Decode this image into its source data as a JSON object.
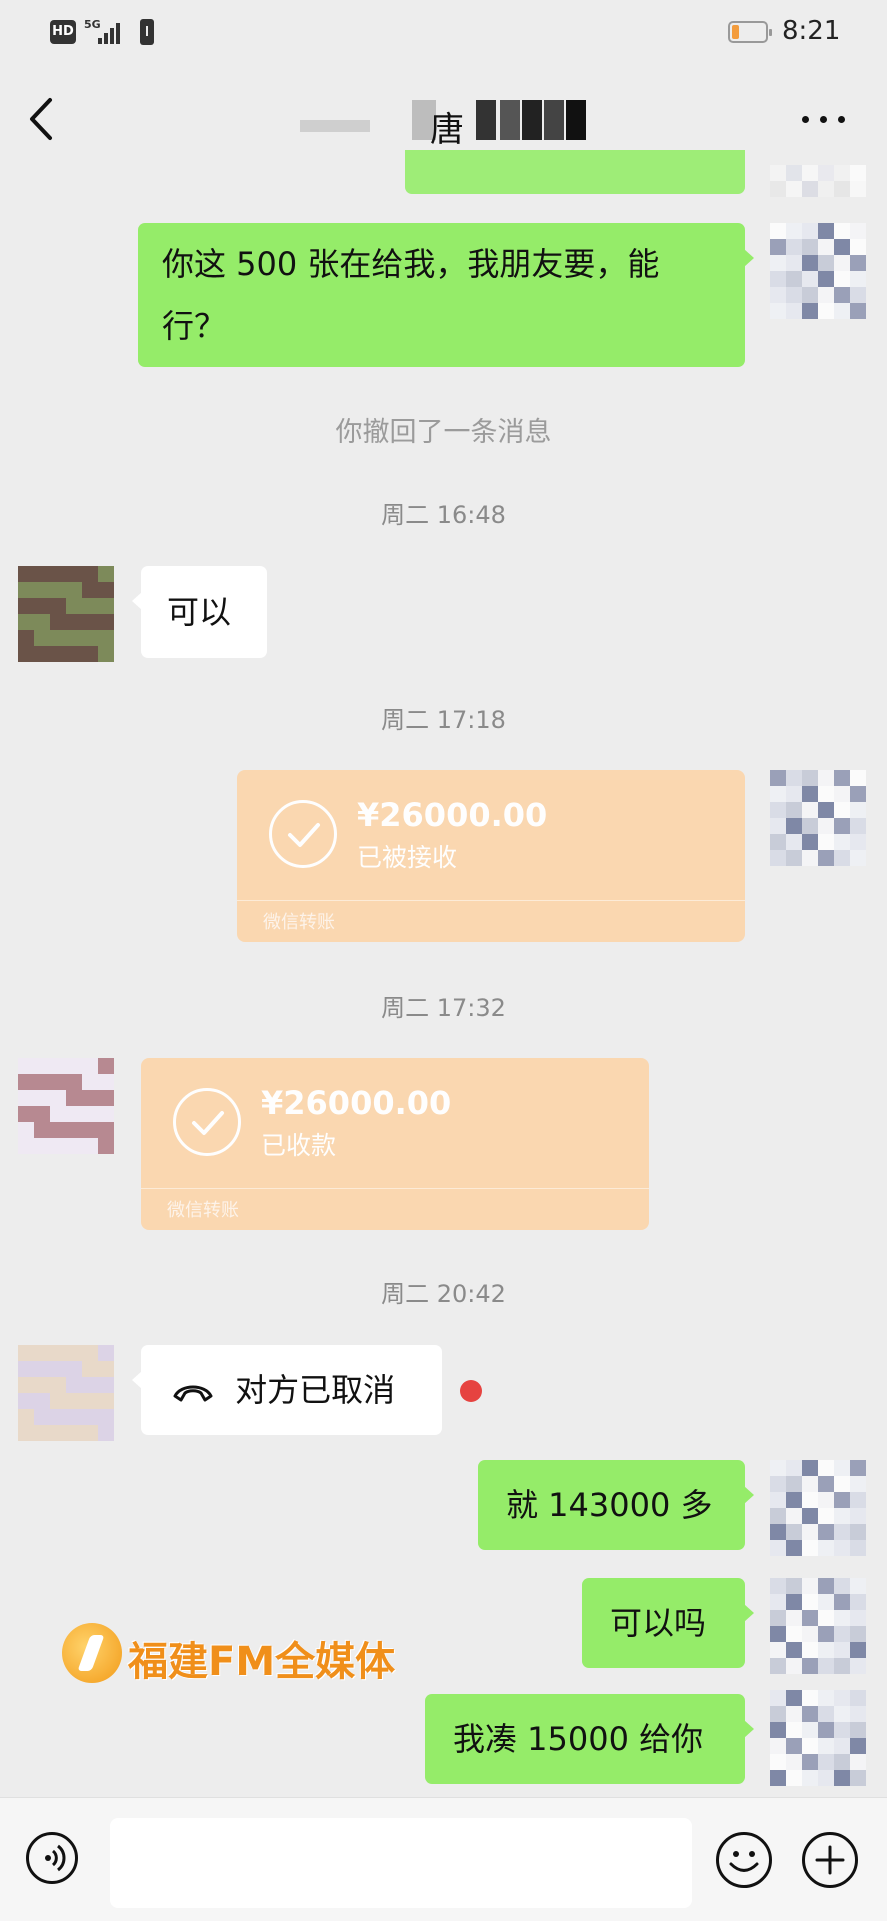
{
  "status_bar": {
    "hd": "HD",
    "network": "5G",
    "time": "8:21"
  },
  "header": {
    "title": "唐"
  },
  "messages": {
    "m1": "你这 500 张在给我，我朋友要，能行？",
    "recall": "你撤回了一条消息",
    "t1": "周二 16:48",
    "m2": "可以",
    "t2": "周二 17:18",
    "transfer1": {
      "amount": "¥26000.00",
      "status": "已被接收",
      "footer": "微信转账"
    },
    "t3": "周二 17:32",
    "transfer2": {
      "amount": "¥26000.00",
      "status": "已收款",
      "footer": "微信转账"
    },
    "t4": "周二 20:42",
    "call": "对方已取消",
    "m3": "就 143000 多",
    "m4": "可以吗",
    "m5": "我凑 15000 给你"
  },
  "watermark": {
    "text": "福建FM全媒体"
  },
  "colors": {
    "sent": "#95ec69",
    "received": "#ffffff",
    "transfer": "#fbd6ad",
    "unread_dot": "#e64340",
    "background": "#ededed"
  }
}
